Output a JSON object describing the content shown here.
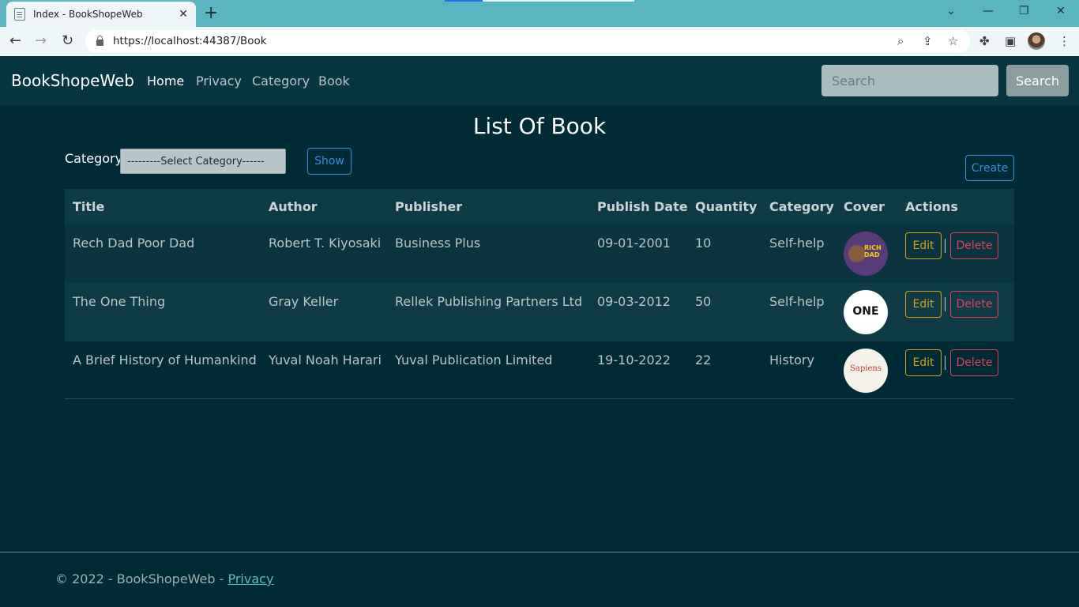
{
  "browser": {
    "tab_title": "Index - BookShopeWeb",
    "tab_close": "✕",
    "new_tab": "+",
    "url": "https://localhost:44387/Book"
  },
  "navbar": {
    "brand": "BookShopeWeb",
    "links": [
      "Home",
      "Privacy",
      "Category",
      "Book"
    ],
    "search_placeholder": "Search",
    "search_button": "Search"
  },
  "main": {
    "title": "List Of Book",
    "category_label": "Category",
    "category_select": "---------Select Category------",
    "show_button": "Show",
    "create_button": "Create"
  },
  "table": {
    "headers": [
      "Title",
      "Author",
      "Publisher",
      "Publish Date",
      "Quantity",
      "Category",
      "Cover",
      "Actions"
    ],
    "rows": [
      {
        "title": "Rech Dad Poor Dad",
        "author": "Robert T. Kiyosaki",
        "publisher": "Business Plus",
        "date": "09-01-2001",
        "quantity": "10",
        "category": "Self-help",
        "cover_text": "RICH DAD"
      },
      {
        "title": "The One Thing",
        "author": "Gray Keller",
        "publisher": "Rellek Publishing Partners Ltd",
        "date": "09-03-2012",
        "quantity": "50",
        "category": "Self-help",
        "cover_text": "ONE"
      },
      {
        "title": "A Brief History of Humankind",
        "author": "Yuval Noah Harari",
        "publisher": "Yuval Publication Limited",
        "date": "19-10-2022",
        "quantity": "22",
        "category": "History",
        "cover_text": "Sapiens"
      }
    ],
    "edit_label": "Edit",
    "delete_label": "Delete"
  },
  "footer": {
    "text": "© 2022 - BookShopeWeb - ",
    "link": "Privacy"
  },
  "colors": {
    "background": "#002b36",
    "navbar": "#073642",
    "edit": "#d4a017",
    "delete": "#e0405f",
    "primary": "#3a8dde"
  }
}
